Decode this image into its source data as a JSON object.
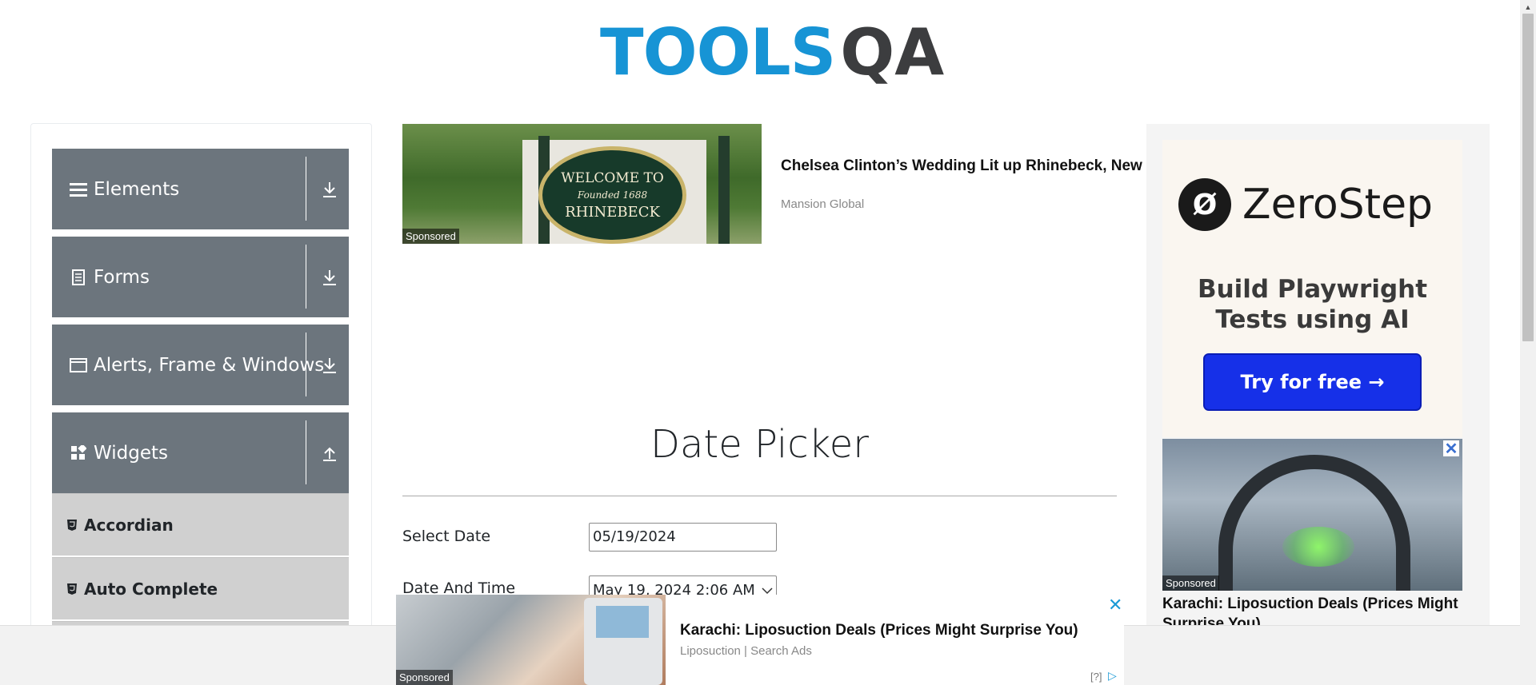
{
  "header": {
    "logo_tools": "TOOLS",
    "logo_qa": "QA"
  },
  "sidebar": {
    "groups": [
      {
        "label": "Elements",
        "icon": "hamburger-icon",
        "arrow": "download-icon"
      },
      {
        "label": "Forms",
        "icon": "document-icon",
        "arrow": "download-icon"
      },
      {
        "label": "Alerts, Frame & Windows",
        "icon": "window-icon",
        "arrow": "download-icon"
      },
      {
        "label": "Widgets",
        "icon": "widgets-icon",
        "arrow": "upload-icon"
      }
    ],
    "items": [
      {
        "label": "Accordian",
        "icon": "html5-icon"
      },
      {
        "label": "Auto Complete",
        "icon": "html5-icon"
      }
    ]
  },
  "ad_top": {
    "sponsored": "Sponsored",
    "sign_line1": "WELCOME TO",
    "sign_line2": "Founded 1688",
    "sign_line3": "RHINEBECK",
    "headline": "Chelsea Clinton’s Wedding Lit up Rhinebeck, New York. Today, This Small Town’s Housing Market Is White Hot",
    "source": "Mansion Global"
  },
  "main": {
    "title": "Date Picker",
    "select_date_label": "Select Date",
    "select_date_value": "05/19/2024",
    "date_time_label": "Date And Time",
    "date_time_value": "May 19, 2024 2:06 AM"
  },
  "ad_right": {
    "brand": "ZeroStep",
    "brand_mark": "Ø",
    "tagline_1": "Build Playwright",
    "tagline_2": "Tests using AI",
    "cta": "Try for free →",
    "sponsored": "Sponsored",
    "close": "✕",
    "lipo_title": "Karachi: Liposuction Deals (Prices Might Surprise You)"
  },
  "ad_bottom": {
    "sponsored": "Sponsored",
    "title": "Karachi: Liposuction Deals (Prices Might Surprise You)",
    "source": "Liposuction | Search Ads",
    "close": "✕",
    "help": "[?]",
    "adchoices": "▷"
  },
  "colors": {
    "accent_blue": "#1794d5",
    "sidebar_gray": "#6c757d",
    "cta_blue": "#1630e8"
  }
}
